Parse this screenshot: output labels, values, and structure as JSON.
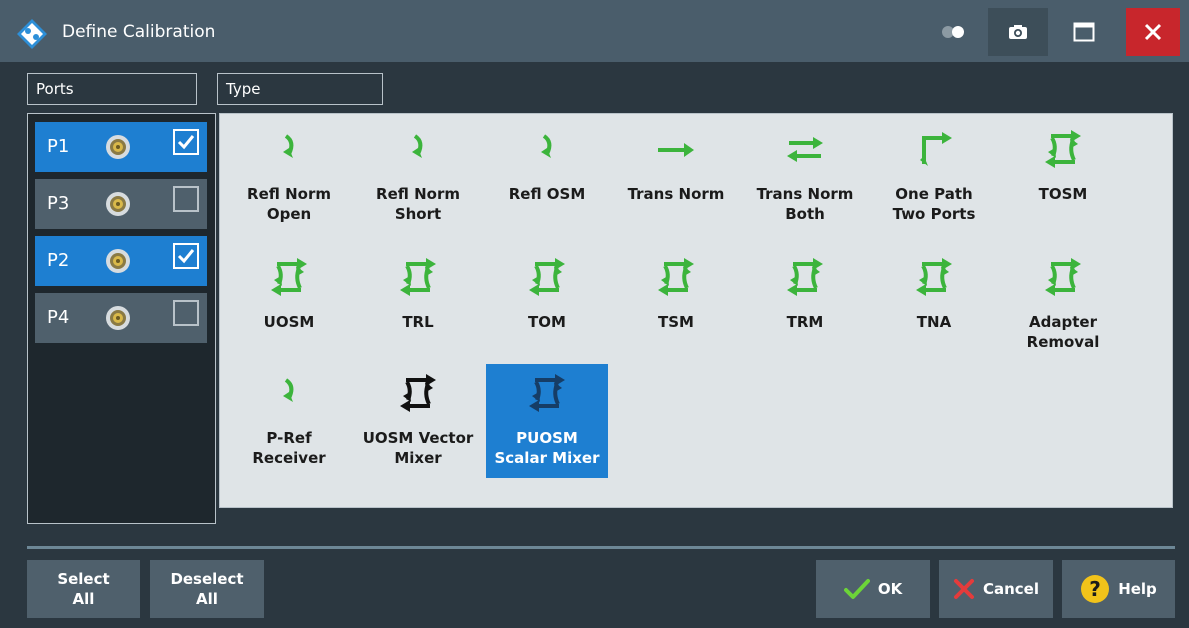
{
  "window": {
    "title": "Define Calibration"
  },
  "titlebar_icons": [
    "toggle-icon",
    "camera-icon",
    "maximize-icon",
    "close-icon"
  ],
  "ports": {
    "label": "Ports",
    "items": [
      {
        "name": "P1",
        "checked": true
      },
      {
        "name": "P3",
        "checked": false
      },
      {
        "name": "P2",
        "checked": true
      },
      {
        "name": "P4",
        "checked": false
      }
    ]
  },
  "type": {
    "label": "Type",
    "selected": "PUOSM Scalar Mixer",
    "items": [
      {
        "label": "Refl Norm\nOpen",
        "icon": "refl-icon"
      },
      {
        "label": "Refl Norm\nShort",
        "icon": "refl-icon"
      },
      {
        "label": "Refl OSM",
        "icon": "refl-icon"
      },
      {
        "label": "Trans Norm",
        "icon": "trans-icon"
      },
      {
        "label": "Trans Norm\nBoth",
        "icon": "trans-both-icon"
      },
      {
        "label": "One Path\nTwo Ports",
        "icon": "one-path-icon"
      },
      {
        "label": "TOSM",
        "icon": "two-port-icon"
      },
      {
        "label": "UOSM",
        "icon": "two-port-icon"
      },
      {
        "label": "TRL",
        "icon": "two-port-icon"
      },
      {
        "label": "TOM",
        "icon": "two-port-icon"
      },
      {
        "label": "TSM",
        "icon": "two-port-icon"
      },
      {
        "label": "TRM",
        "icon": "two-port-icon"
      },
      {
        "label": "TNA",
        "icon": "two-port-icon"
      },
      {
        "label": "Adapter\nRemoval",
        "icon": "two-port-icon"
      },
      {
        "label": "P-Ref\nReceiver",
        "icon": "refl-icon"
      },
      {
        "label": "UOSM Vector\nMixer",
        "icon": "two-port-black-icon"
      },
      {
        "label": "PUOSM\nScalar Mixer",
        "icon": "two-port-dark-icon"
      }
    ]
  },
  "buttons": {
    "select_all": "Select\nAll",
    "deselect_all": "Deselect\nAll",
    "ok": "OK",
    "cancel": "Cancel",
    "help": "Help"
  },
  "colors": {
    "accent": "#1e7fd1",
    "icon_green": "#3cb43c",
    "close_red": "#c8262c"
  }
}
